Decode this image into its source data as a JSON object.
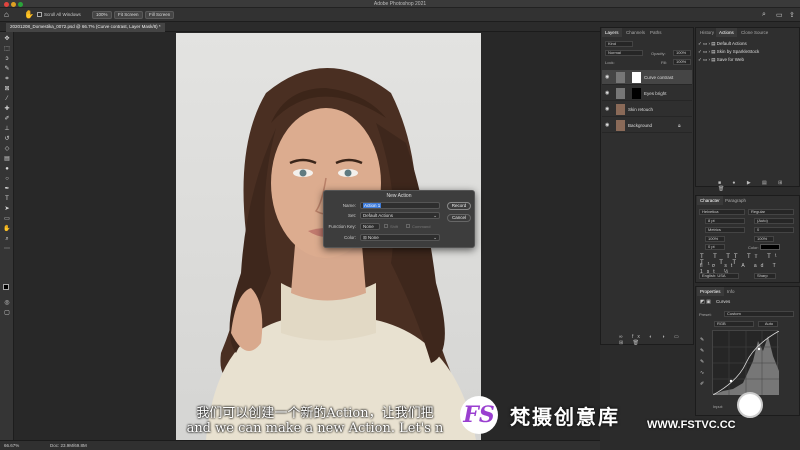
{
  "window": {
    "title": "Adobe Photoshop 2021"
  },
  "options_bar": {
    "scroll_all_windows": "Scroll All Windows",
    "zoom": "100%",
    "fit_screen": "Fit Screen",
    "fill_screen": "Fill Screen"
  },
  "document": {
    "tab_label": "20201208_Domestika_0072.psd @ 66.7% (Curve contrast, Layer Mask/8) *"
  },
  "status": {
    "zoom": "66.67%",
    "doc_size": "Doc: 23.9M/69.8M"
  },
  "dialog": {
    "title": "New Action",
    "name_label": "Name:",
    "name_value": "Action 1",
    "set_label": "Set:",
    "set_value": "Default Actions",
    "function_key_label": "Function Key:",
    "function_key_value": "None",
    "shift_label": "Shift",
    "command_label": "Command",
    "color_label": "Color:",
    "color_value": "None",
    "record_button": "Record",
    "cancel_button": "Cancel"
  },
  "layers_panel": {
    "tabs": [
      "Layers",
      "Channels",
      "Paths"
    ],
    "filter": "Kind",
    "blend_mode": "Normal",
    "opacity_label": "Opacity:",
    "opacity_value": "100%",
    "lock_label": "Lock:",
    "fill_label": "Fill:",
    "fill_value": "100%",
    "layers": [
      {
        "name": "Curve contrast"
      },
      {
        "name": "Eyes bright"
      },
      {
        "name": "Skin retouch"
      },
      {
        "name": "Background"
      }
    ]
  },
  "actions_panel": {
    "tabs": [
      "History",
      "Actions",
      "Clone Source"
    ],
    "items": [
      "Default Actions",
      "Skin by SparkleStock",
      "Save for Web"
    ]
  },
  "character_panel": {
    "tabs": [
      "Character",
      "Paragraph"
    ],
    "font_family": "Helvetica",
    "font_style": "Regular",
    "size": "8 pt",
    "leading": "(Auto)",
    "kerning": "Metrics",
    "tracking": "0",
    "vscale": "100%",
    "hscale": "100%",
    "baseline": "0 pt",
    "color_label": "Color:",
    "language": "English: USA",
    "aa": "Sharp"
  },
  "properties_panel": {
    "tabs": [
      "Properties",
      "Info"
    ],
    "type_label": "Curves",
    "preset_label": "Preset:",
    "preset_value": "Custom",
    "channel": "RGB",
    "auto_button": "Auto",
    "input_label": "Input:"
  },
  "overlay": {
    "subtitle_zh": "我们可以创建一个新的Action，让我们把",
    "subtitle_en": "and we can make a new Action. Let's n",
    "watermark_logo": "FS",
    "watermark_cn": "梵摄创意库",
    "watermark_url": "WWW.FSTVC.CC"
  },
  "colors": {
    "selection_blue": "#3c7ad9",
    "panel_bg": "#2f2f2f",
    "accent_purple": "#9a3fd0"
  }
}
